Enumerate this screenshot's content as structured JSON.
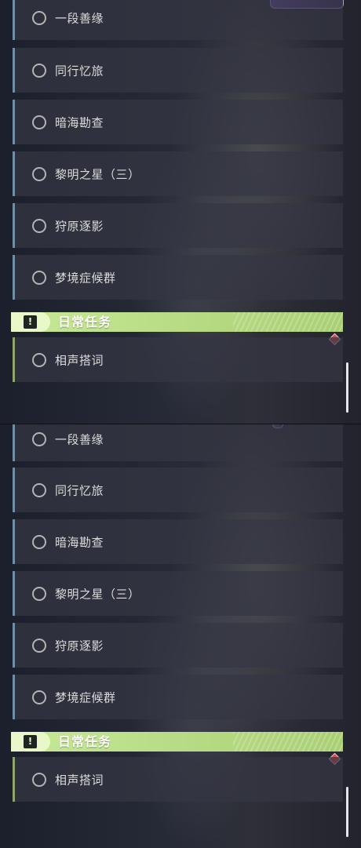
{
  "panels": [
    {
      "quests": [
        {
          "label": "一段善缘"
        },
        {
          "label": "同行忆旅"
        },
        {
          "label": "暗海勘查"
        },
        {
          "label": "黎明之星（三）"
        },
        {
          "label": "狩原逐影"
        },
        {
          "label": "梦境症候群"
        }
      ],
      "section": {
        "title": "日常任务",
        "icon": "exclamation-icon"
      },
      "daily_quests": [
        {
          "label": "相声搭词"
        }
      ]
    },
    {
      "quests": [
        {
          "label": "一段善缘"
        },
        {
          "label": "同行忆旅"
        },
        {
          "label": "暗海勘查"
        },
        {
          "label": "黎明之星（三）"
        },
        {
          "label": "狩原逐影"
        },
        {
          "label": "梦境症候群"
        }
      ],
      "section": {
        "title": "日常任务",
        "icon": "exclamation-icon"
      },
      "daily_quests": [
        {
          "label": "相声搭词"
        }
      ]
    }
  ],
  "colors": {
    "section_header": "#b5da80",
    "quest_accent": "#6f8fa6",
    "daily_accent": "#8fa56a",
    "marker": "#d84b55"
  }
}
